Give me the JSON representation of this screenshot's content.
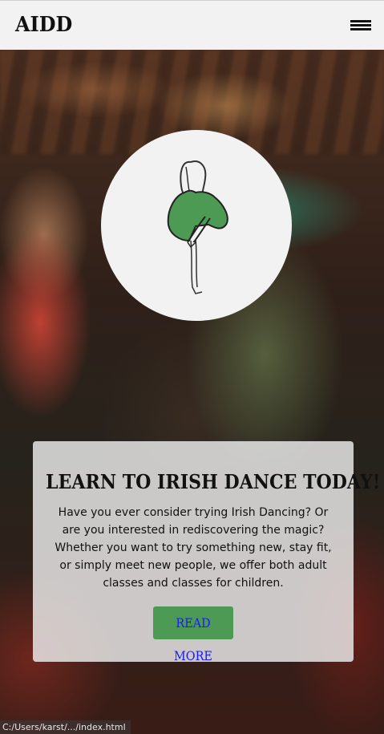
{
  "header": {
    "brand": "AIDD",
    "menu_icon": "hamburger-menu-icon"
  },
  "hero": {
    "logo_icon": "irish-dancer-logo-icon",
    "card": {
      "title": "LEARN TO IRISH DANCE TODAY!",
      "body": "Have you ever consider trying Irish Dancing? Or are you interested in rediscovering the magic? Whether you want to try something new, stay fit, or simply meet new people, we offer both adult classes and classes for children.",
      "button_label": "READ MORE"
    }
  },
  "statusbar": {
    "url": "C:/Users/karst/.../index.html"
  },
  "colors": {
    "header_bg": "#f2f2f2",
    "button_bg": "#4d9a55",
    "button_text": "#1a1aff",
    "logo_dress": "#4d9a55"
  }
}
